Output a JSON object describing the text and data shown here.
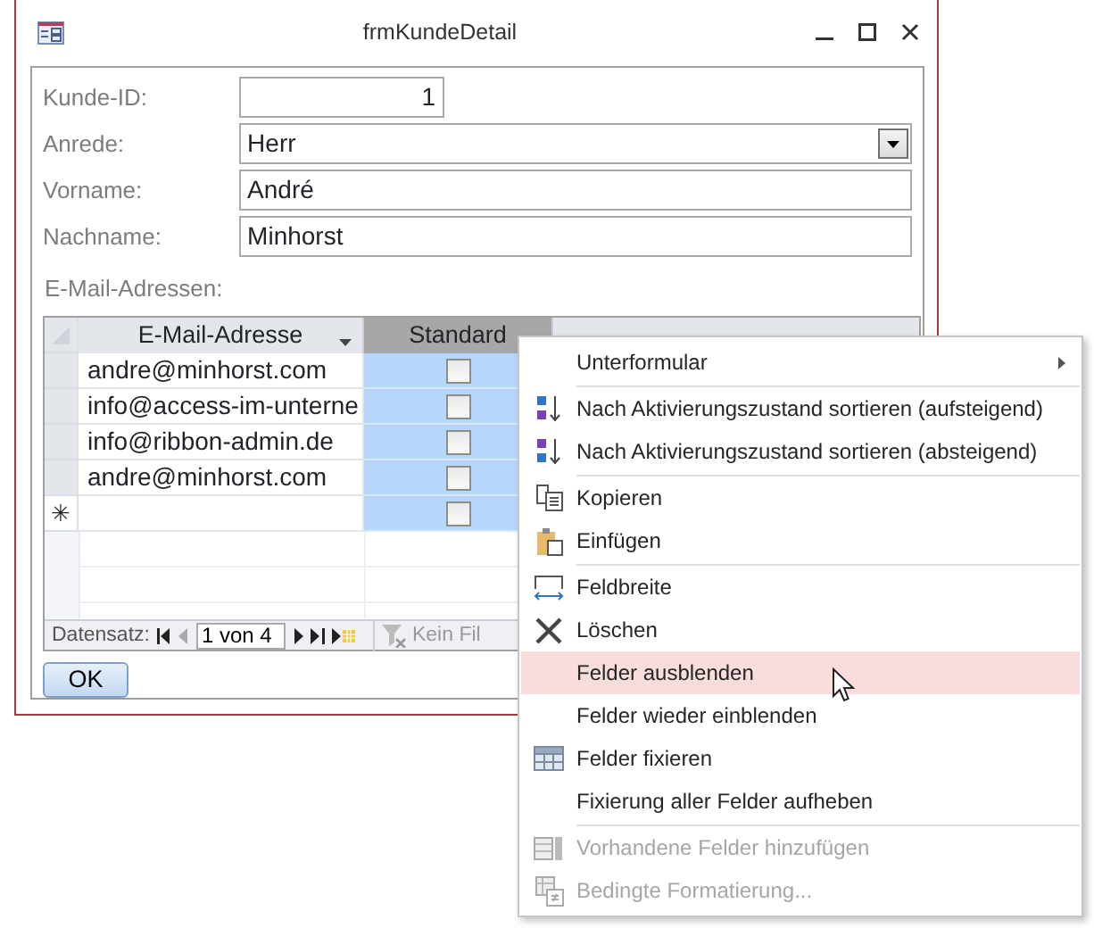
{
  "window": {
    "title": "frmKundeDetail"
  },
  "fields": [
    {
      "label": "Kunde-ID:",
      "value": "1",
      "kind": "number"
    },
    {
      "label": "Anrede:",
      "value": "Herr",
      "kind": "combo"
    },
    {
      "label": "Vorname:",
      "value": "André",
      "kind": "text"
    },
    {
      "label": "Nachname:",
      "value": "Minhorst",
      "kind": "text"
    }
  ],
  "subform": {
    "label": "E-Mail-Adressen:",
    "columns": [
      {
        "label": "E-Mail-Adresse",
        "selected": false
      },
      {
        "label": "Standard",
        "selected": true
      }
    ],
    "rows": [
      {
        "email": "andre@minhorst.com",
        "checked": false
      },
      {
        "email": "info@access-im-unterne",
        "checked": false
      },
      {
        "email": "info@ribbon-admin.de",
        "checked": false
      },
      {
        "email": "andre@minhorst.com",
        "checked": false
      }
    ],
    "new_row": {
      "marker": "✳",
      "checked": false
    },
    "navigation": {
      "label": "Datensatz:",
      "record": "1 von 4",
      "filter": "Kein Fil"
    }
  },
  "ok_button": "OK",
  "menu": {
    "items": [
      {
        "kind": "submenu",
        "label": "Unterformular",
        "highlighted": false,
        "disabled": false,
        "separator_after": true
      },
      {
        "kind": "sort-asc",
        "label": "Nach Aktivierungszustand sortieren (aufsteigend)",
        "highlighted": false,
        "disabled": false,
        "separator_after": false
      },
      {
        "kind": "sort-desc",
        "label": "Nach Aktivierungszustand sortieren (absteigend)",
        "highlighted": false,
        "disabled": false,
        "separator_after": true
      },
      {
        "kind": "copy",
        "label": "Kopieren",
        "highlighted": false,
        "disabled": false,
        "separator_after": false
      },
      {
        "kind": "paste",
        "label": "Einfügen",
        "highlighted": false,
        "disabled": false,
        "separator_after": true
      },
      {
        "kind": "width",
        "label": "Feldbreite",
        "highlighted": false,
        "disabled": false,
        "separator_after": false
      },
      {
        "kind": "delete",
        "label": "Löschen",
        "highlighted": false,
        "disabled": false,
        "separator_after": false
      },
      {
        "kind": "plain",
        "label": "Felder ausblenden",
        "highlighted": true,
        "disabled": false,
        "separator_after": false
      },
      {
        "kind": "plain",
        "label": "Felder wieder einblenden",
        "highlighted": false,
        "disabled": false,
        "separator_after": false
      },
      {
        "kind": "grid",
        "label": "Felder fixieren",
        "highlighted": false,
        "disabled": false,
        "separator_after": false
      },
      {
        "kind": "plain",
        "label": "Fixierung aller Felder aufheben",
        "highlighted": false,
        "disabled": false,
        "separator_after": true
      },
      {
        "kind": "add-fields",
        "label": "Vorhandene Felder hinzufügen",
        "highlighted": false,
        "disabled": true,
        "separator_after": false
      },
      {
        "kind": "conditional",
        "label": "Bedingte Formatierung...",
        "highlighted": false,
        "disabled": true,
        "separator_after": false
      }
    ]
  }
}
